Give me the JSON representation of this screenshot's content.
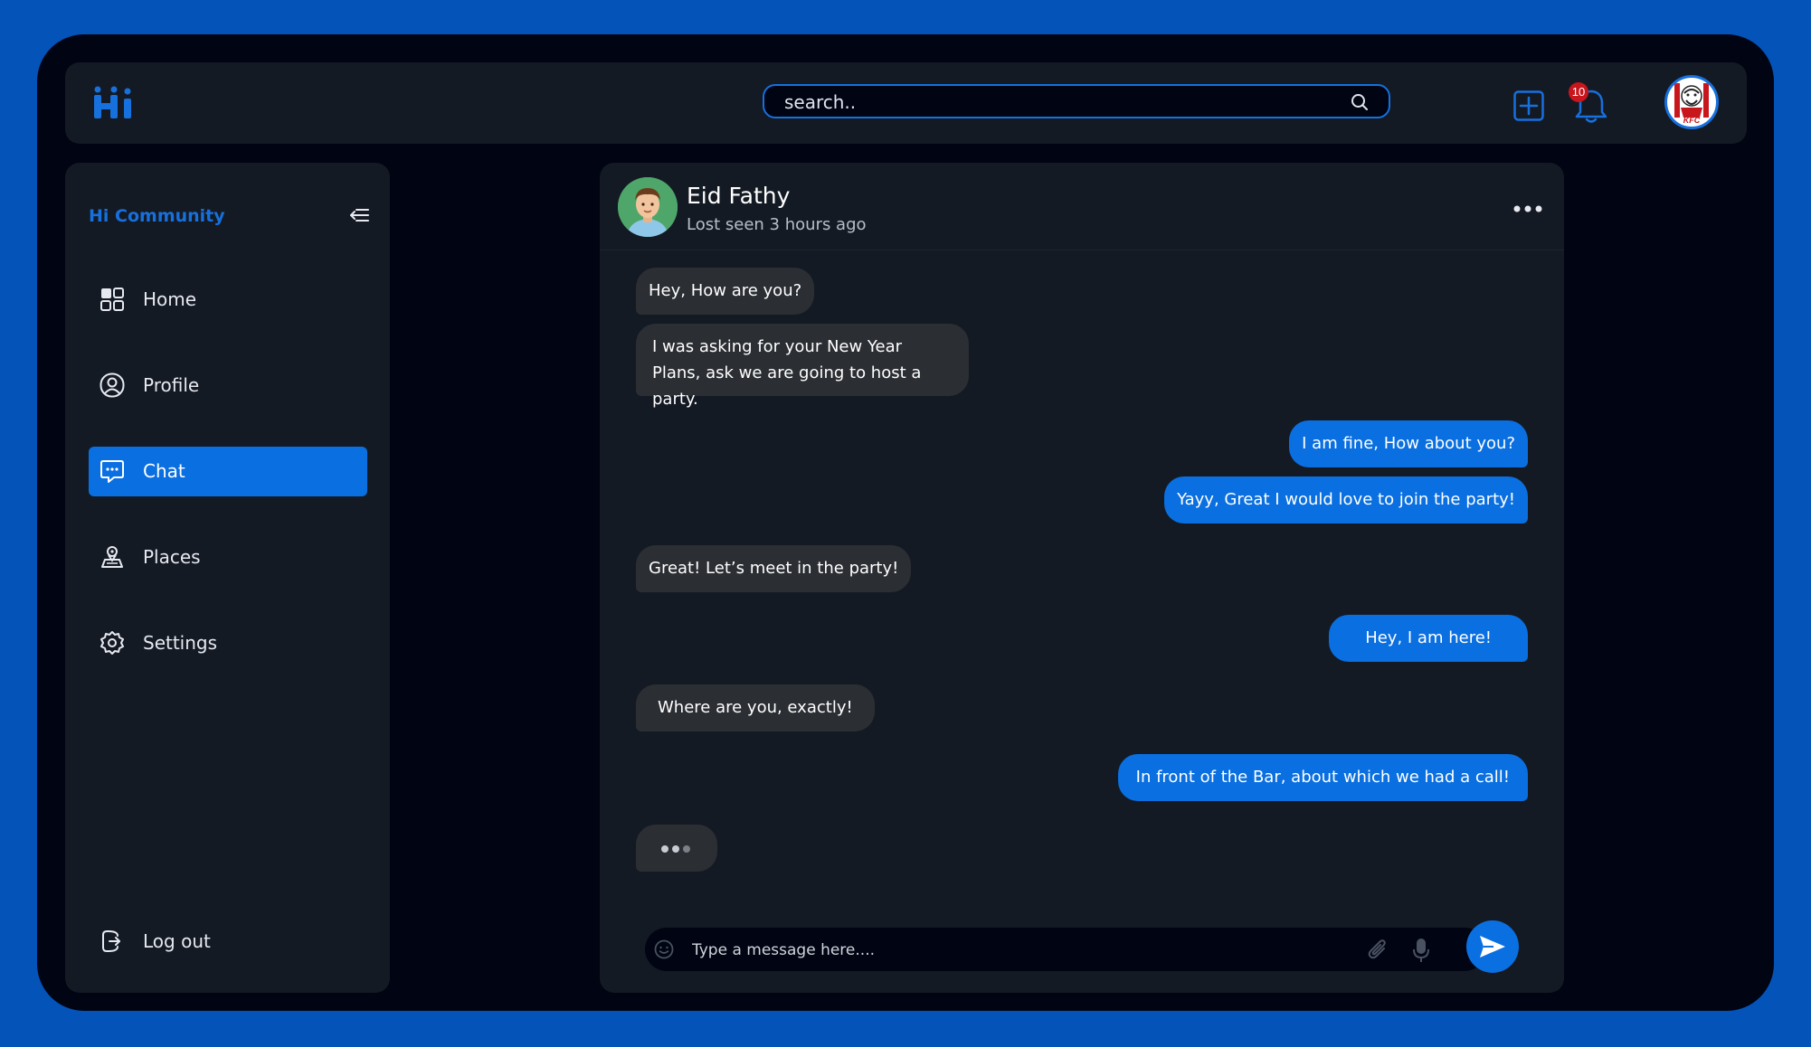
{
  "header": {
    "logo_text": "Hi",
    "search": {
      "placeholder": "search..",
      "value": ""
    },
    "notifications": {
      "count": "10"
    },
    "account_avatar": {
      "label": "KFC"
    }
  },
  "sidebar": {
    "title": "Hi Community",
    "items": [
      {
        "label": "Home",
        "icon": "grid-icon",
        "active": false
      },
      {
        "label": "Profile",
        "icon": "user-icon",
        "active": false
      },
      {
        "label": "Chat",
        "icon": "chat-icon",
        "active": true
      },
      {
        "label": "Places",
        "icon": "places-icon",
        "active": false
      },
      {
        "label": "Settings",
        "icon": "gear-icon",
        "active": false
      }
    ],
    "logout_label": "Log out"
  },
  "chat": {
    "contact_name": "Eid Fathy",
    "contact_status": "Lost seen 3 hours ago",
    "messages": [
      {
        "from": "them",
        "text": "Hey, How are you?"
      },
      {
        "from": "them",
        "text": "I was asking for your New Year Plans, ask we are going to host a party."
      },
      {
        "from": "me",
        "text": "I am fine, How about you?"
      },
      {
        "from": "me",
        "text": "Yayy, Great I would love to join the party!"
      },
      {
        "from": "them",
        "text": "Great! Let’s meet in the party!"
      },
      {
        "from": "me",
        "text": "Hey, I am here!"
      },
      {
        "from": "them",
        "text": "Where are you, exactly!"
      },
      {
        "from": "me",
        "text": "In front of the Bar, about which we had a call!"
      }
    ],
    "composer_placeholder": "Type a message here...."
  },
  "colors": {
    "frame": "#0453b8",
    "background": "#000413",
    "panel": "#141a24",
    "accent": "#0a6fe0",
    "incoming_bubble": "#2b2e33",
    "badge": "#c8161d"
  }
}
